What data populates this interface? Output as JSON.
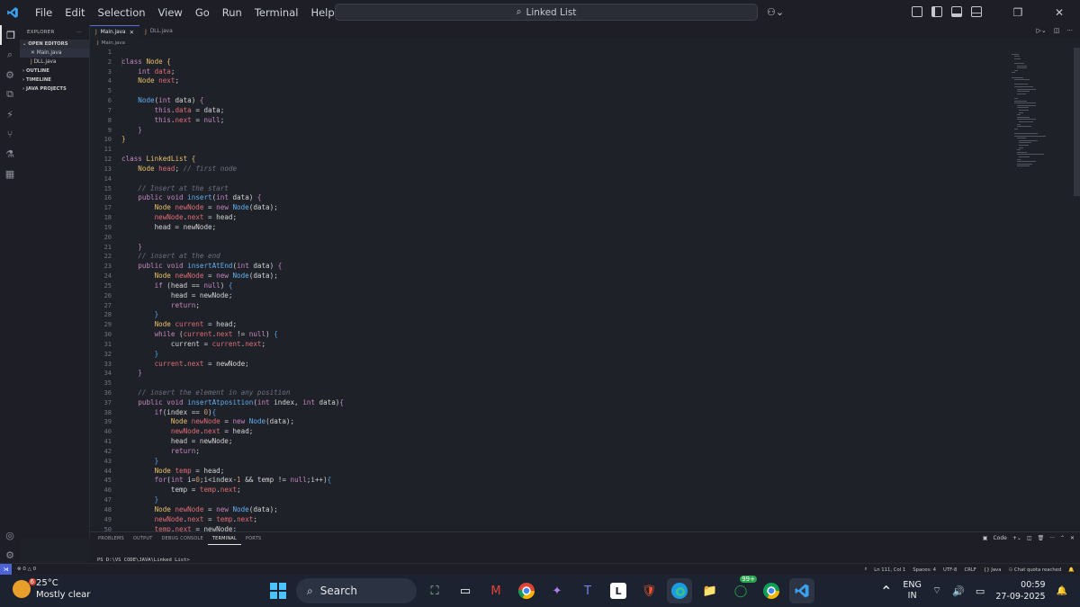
{
  "menu": [
    "File",
    "Edit",
    "Selection",
    "View",
    "Go",
    "Run",
    "Terminal",
    "Help"
  ],
  "command_center": {
    "text": "Linked List"
  },
  "sidebar": {
    "title": "EXPLORER",
    "open_editors": "OPEN EDITORS",
    "files": [
      "Main.java",
      "DLL.java"
    ],
    "sections": [
      "OUTLINE",
      "TIMELINE",
      "JAVA PROJECTS"
    ]
  },
  "tabs": [
    {
      "label": "Main.java",
      "active": true
    },
    {
      "label": "DLL.java",
      "active": false
    }
  ],
  "breadcrumb": "Main.java",
  "editor": {
    "line_numbers": [
      "1",
      "2",
      "3",
      "4",
      "5",
      "6",
      "7",
      "8",
      "9",
      "10",
      "11",
      "12",
      "13",
      "14",
      "15",
      "16",
      "17",
      "18",
      "19",
      "20",
      "21",
      "22",
      "23",
      "24",
      "25",
      "26",
      "27",
      "28",
      "29",
      "30",
      "31",
      "32",
      "33",
      "34",
      "35",
      "36",
      "37",
      "38",
      "39",
      "40",
      "41",
      "42",
      "43",
      "44",
      "45",
      "46",
      "47",
      "48",
      "49",
      "50"
    ],
    "lines": [
      [],
      [
        [
          "class ",
          "kw"
        ],
        [
          "Node",
          "ty"
        ],
        [
          " {",
          "br"
        ]
      ],
      [
        [
          "    "
        ],
        [
          "int",
          "kw"
        ],
        [
          " data",
          "va"
        ],
        [
          ";"
        ]
      ],
      [
        [
          "    "
        ],
        [
          "Node",
          "ty"
        ],
        [
          " next",
          "va"
        ],
        [
          ";"
        ]
      ],
      [],
      [
        [
          "    "
        ],
        [
          "Node",
          "fn"
        ],
        [
          "("
        ],
        [
          "int",
          "kw"
        ],
        [
          " data) "
        ],
        [
          "{",
          "br2"
        ]
      ],
      [
        [
          "        "
        ],
        [
          "this",
          "kw"
        ],
        [
          "."
        ],
        [
          "data",
          "va"
        ],
        [
          " = data;"
        ]
      ],
      [
        [
          "        "
        ],
        [
          "this",
          "kw"
        ],
        [
          "."
        ],
        [
          "next",
          "va"
        ],
        [
          " = "
        ],
        [
          "null",
          "kw"
        ],
        [
          ";"
        ]
      ],
      [
        [
          "    "
        ],
        [
          "}",
          "br2"
        ]
      ],
      [
        [
          "}",
          "br"
        ]
      ],
      [],
      [
        [
          "class ",
          "kw"
        ],
        [
          "LinkedList",
          "ty"
        ],
        [
          " {",
          "br"
        ]
      ],
      [
        [
          "    "
        ],
        [
          "Node",
          "ty"
        ],
        [
          " head",
          "va"
        ],
        [
          "; "
        ],
        [
          "// first node",
          "cm"
        ]
      ],
      [],
      [
        [
          "    "
        ],
        [
          "// Insert at the start",
          "cm"
        ]
      ],
      [
        [
          "    "
        ],
        [
          "public void ",
          "kw"
        ],
        [
          "insert",
          "fn"
        ],
        [
          "("
        ],
        [
          "int",
          "kw"
        ],
        [
          " data) "
        ],
        [
          "{",
          "br2"
        ]
      ],
      [
        [
          "        "
        ],
        [
          "Node",
          "ty"
        ],
        [
          " newNode",
          "va"
        ],
        [
          " = "
        ],
        [
          "new ",
          "kw"
        ],
        [
          "Node",
          "fn"
        ],
        [
          "(data);"
        ]
      ],
      [
        [
          "        "
        ],
        [
          "newNode",
          "va"
        ],
        [
          "."
        ],
        [
          "next",
          "va"
        ],
        [
          " = head;"
        ]
      ],
      [
        [
          "        "
        ],
        [
          "head = newNode;"
        ]
      ],
      [],
      [
        [
          "    "
        ],
        [
          "}",
          "br2"
        ]
      ],
      [
        [
          "    "
        ],
        [
          "// insert at the end",
          "cm"
        ]
      ],
      [
        [
          "    "
        ],
        [
          "public void ",
          "kw"
        ],
        [
          "insertAtEnd",
          "fn"
        ],
        [
          "("
        ],
        [
          "int",
          "kw"
        ],
        [
          " data) "
        ],
        [
          "{",
          "br2"
        ]
      ],
      [
        [
          "        "
        ],
        [
          "Node",
          "ty"
        ],
        [
          " newNode",
          "va"
        ],
        [
          " = "
        ],
        [
          "new ",
          "kw"
        ],
        [
          "Node",
          "fn"
        ],
        [
          "(data);"
        ]
      ],
      [
        [
          "        "
        ],
        [
          "if ",
          "kw"
        ],
        [
          "(head == "
        ],
        [
          "null",
          "kw"
        ],
        [
          ") "
        ],
        [
          "{",
          "br3"
        ]
      ],
      [
        [
          "            "
        ],
        [
          "head = newNode;"
        ]
      ],
      [
        [
          "            "
        ],
        [
          "return",
          "kw"
        ],
        [
          ";"
        ]
      ],
      [
        [
          "        "
        ],
        [
          "}",
          "br3"
        ]
      ],
      [
        [
          "        "
        ],
        [
          "Node",
          "ty"
        ],
        [
          " current",
          "va"
        ],
        [
          " = head;"
        ]
      ],
      [
        [
          "        "
        ],
        [
          "while ",
          "kw"
        ],
        [
          "("
        ],
        [
          "current",
          "va"
        ],
        [
          "."
        ],
        [
          "next",
          "va"
        ],
        [
          " != "
        ],
        [
          "null",
          "kw"
        ],
        [
          ") "
        ],
        [
          "{",
          "br3"
        ]
      ],
      [
        [
          "            "
        ],
        [
          "current = "
        ],
        [
          "current",
          "va"
        ],
        [
          "."
        ],
        [
          "next",
          "va"
        ],
        [
          ";"
        ]
      ],
      [
        [
          "        "
        ],
        [
          "}",
          "br3"
        ]
      ],
      [
        [
          "        "
        ],
        [
          "current",
          "va"
        ],
        [
          "."
        ],
        [
          "next",
          "va"
        ],
        [
          " = newNode;"
        ]
      ],
      [
        [
          "    "
        ],
        [
          "}",
          "br2"
        ]
      ],
      [],
      [
        [
          "    "
        ],
        [
          "// insert the element in any position",
          "cm"
        ]
      ],
      [
        [
          "    "
        ],
        [
          "public void ",
          "kw"
        ],
        [
          "insertAtposition",
          "fn"
        ],
        [
          "("
        ],
        [
          "int",
          "kw"
        ],
        [
          " index, "
        ],
        [
          "int",
          "kw"
        ],
        [
          " data)"
        ],
        [
          "{",
          "br2"
        ]
      ],
      [
        [
          "        "
        ],
        [
          "if",
          "kw"
        ],
        [
          "(index == "
        ],
        [
          "0",
          "nu"
        ],
        [
          ")"
        ],
        [
          "{",
          "br3"
        ]
      ],
      [
        [
          "            "
        ],
        [
          "Node",
          "ty"
        ],
        [
          " newNode",
          "va"
        ],
        [
          " = "
        ],
        [
          "new ",
          "kw"
        ],
        [
          "Node",
          "fn"
        ],
        [
          "(data);"
        ]
      ],
      [
        [
          "            "
        ],
        [
          "newNode",
          "va"
        ],
        [
          "."
        ],
        [
          "next",
          "va"
        ],
        [
          " = head;"
        ]
      ],
      [
        [
          "            "
        ],
        [
          "head = newNode;"
        ]
      ],
      [
        [
          "            "
        ],
        [
          "return",
          "kw"
        ],
        [
          ";"
        ]
      ],
      [
        [
          "        "
        ],
        [
          "}",
          "br3"
        ]
      ],
      [
        [
          "        "
        ],
        [
          "Node",
          "ty"
        ],
        [
          " temp",
          "va"
        ],
        [
          " = head;"
        ]
      ],
      [
        [
          "        "
        ],
        [
          "for",
          "kw"
        ],
        [
          "("
        ],
        [
          "int",
          "kw"
        ],
        [
          " i="
        ],
        [
          "0",
          "nu"
        ],
        [
          ";i<index-"
        ],
        [
          "1",
          "nu"
        ],
        [
          " && temp != "
        ],
        [
          "null",
          "kw"
        ],
        [
          ";i++)"
        ],
        [
          "{",
          "br3"
        ]
      ],
      [
        [
          "            "
        ],
        [
          "temp = "
        ],
        [
          "temp",
          "va"
        ],
        [
          "."
        ],
        [
          "next",
          "va"
        ],
        [
          ";"
        ]
      ],
      [
        [
          "        "
        ],
        [
          "}",
          "br3"
        ]
      ],
      [
        [
          "        "
        ],
        [
          "Node",
          "ty"
        ],
        [
          " newNode",
          "va"
        ],
        [
          " = "
        ],
        [
          "new ",
          "kw"
        ],
        [
          "Node",
          "fn"
        ],
        [
          "(data);"
        ]
      ],
      [
        [
          "        "
        ],
        [
          "newNode",
          "va"
        ],
        [
          "."
        ],
        [
          "next",
          "va"
        ],
        [
          " = "
        ],
        [
          "temp",
          "va"
        ],
        [
          "."
        ],
        [
          "next",
          "va"
        ],
        [
          ";"
        ]
      ],
      [
        [
          "        "
        ],
        [
          "temp",
          "va"
        ],
        [
          "."
        ],
        [
          "next",
          "va"
        ],
        [
          " = newNode;"
        ]
      ]
    ]
  },
  "syntax_colors": {
    "kw": "#c586c0",
    "ty": "#e8c06a",
    "fn": "#61afef",
    "va": "#e06c75",
    "cm": "#6a7180",
    "nu": "#d19a66",
    "br": "#e8c06a",
    "br2": "#c586c0",
    "br3": "#4fa3e8",
    "text": "#d4d4d4"
  },
  "panel": {
    "tabs": [
      "PROBLEMS",
      "OUTPUT",
      "DEBUG CONSOLE",
      "TERMINAL",
      "PORTS"
    ],
    "active_tab": "TERMINAL",
    "terminal_label": "Code",
    "prompt": "PS D:\\VS CODE\\JAVA\\Linked List>"
  },
  "statusbar": {
    "errors": "0",
    "warnings": "0",
    "position": "Ln 111, Col 1",
    "spaces": "Spaces: 4",
    "encoding": "UTF-8",
    "eol": "CRLF",
    "language": "{} Java",
    "chat": "Chat quota reached"
  },
  "taskbar": {
    "temperature": "25°C",
    "weather": "Mostly clear",
    "weather_badge": "6",
    "search": "Search",
    "whatsapp_badge": "99+",
    "lang1": "ENG",
    "lang2": "IN",
    "time": "00:59",
    "date": "27-09-2025"
  }
}
